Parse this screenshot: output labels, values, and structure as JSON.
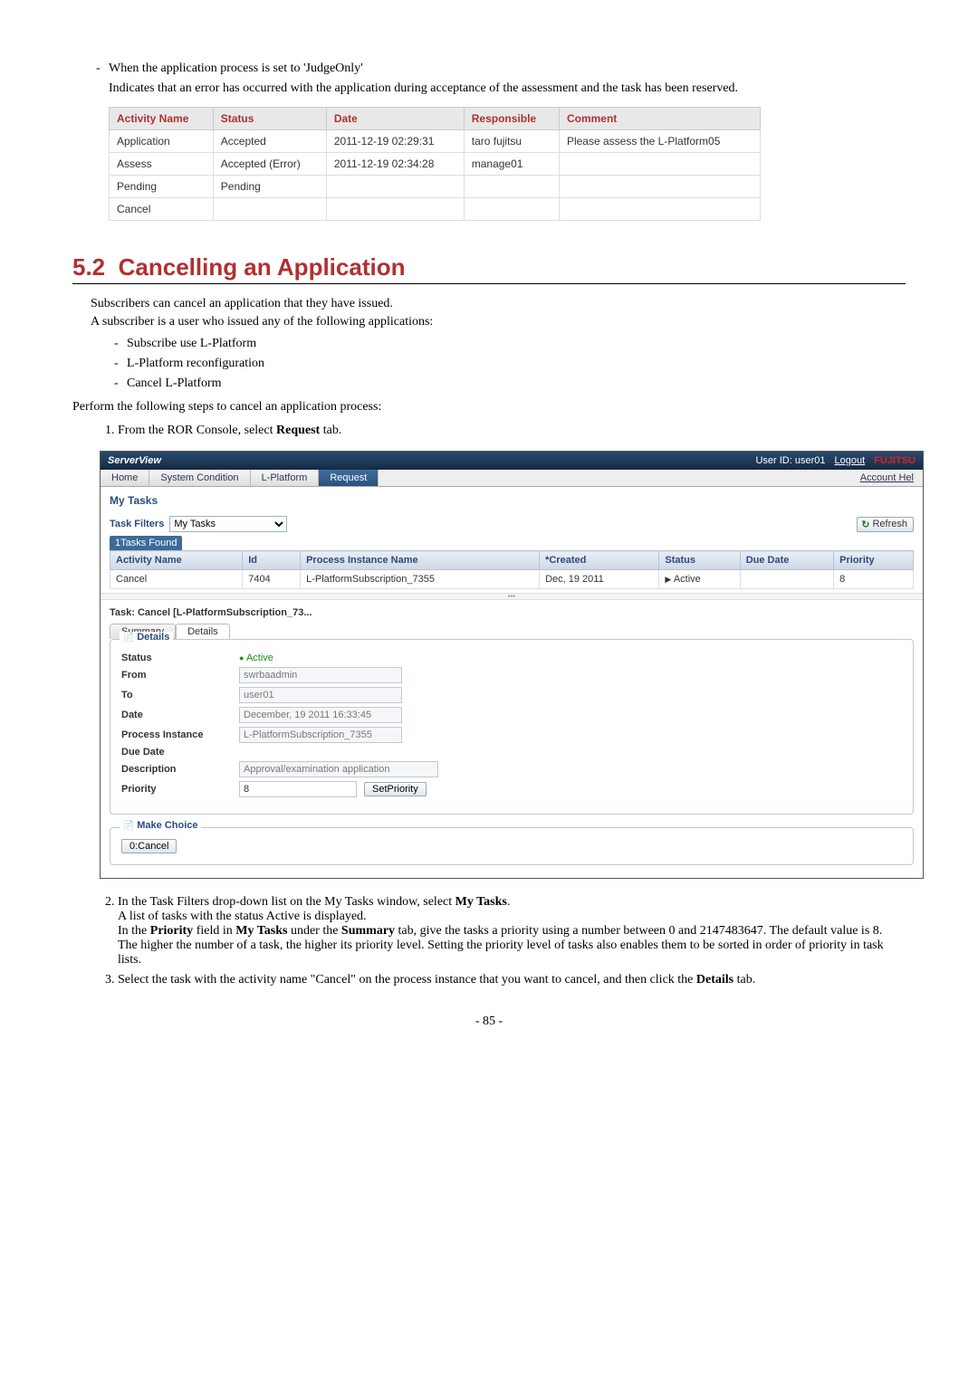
{
  "intro": {
    "bullet1": "When the application process is set to 'JudgeOnly'",
    "bullet1_desc": "Indicates that an error has occurred with the application during acceptance of the assessment and the task has been reserved."
  },
  "status_table": {
    "headers": [
      "Activity Name",
      "Status",
      "Date",
      "Responsible",
      "Comment"
    ],
    "rows": [
      [
        "Application",
        "Accepted",
        "2011-12-19 02:29:31",
        "taro fujitsu",
        "Please assess the L-Platform05"
      ],
      [
        "Assess",
        "Accepted (Error)",
        "2011-12-19 02:34:28",
        "manage01",
        ""
      ],
      [
        "Pending",
        "Pending",
        "",
        "",
        ""
      ],
      [
        "Cancel",
        "",
        "",
        "",
        ""
      ]
    ]
  },
  "section": {
    "number": "5.2",
    "title": "Cancelling an Application",
    "p1": "Subscribers can cancel an application that they have issued.",
    "p2": "A subscriber is a user who issued any of the following applications:",
    "bullets": [
      "Subscribe use L-Platform",
      "L-Platform reconfiguration",
      "Cancel L-Platform"
    ],
    "p3": "Perform the following steps to cancel an application process:",
    "step1_a": "From the ROR Console, select ",
    "step1_b": "Request",
    "step1_c": " tab."
  },
  "sv": {
    "brand": "ServerView",
    "user_label": "User ID: user01",
    "logout": "Logout",
    "vendor": "FUJITSU",
    "tabs": [
      "Home",
      "System Condition",
      "L-Platform",
      "Request"
    ],
    "account": "Account  Hel",
    "mytasks": "My Tasks",
    "filters_label": "Task Filters",
    "filters_value": "My Tasks",
    "refresh": "Refresh",
    "count": "1Tasks Found",
    "cols": [
      "Activity Name",
      "Id",
      "Process Instance Name",
      "*Created",
      "Status",
      "Due Date",
      "Priority"
    ],
    "row": {
      "activity": "Cancel",
      "id": "7404",
      "process": "L-PlatformSubscription_7355",
      "created": "Dec, 19 2011",
      "status": "Active",
      "due": "",
      "priority": "8"
    },
    "detail_title": "Task: Cancel [L-PlatformSubscription_73...",
    "inner_tabs": [
      "Summary",
      "Details"
    ],
    "legend_details": "Details",
    "fields": {
      "status_label": "Status",
      "status_value": "Active",
      "from_label": "From",
      "from_value": "swrbaadmin",
      "to_label": "To",
      "to_value": "user01",
      "date_label": "Date",
      "date_value": "December, 19 2011 16:33:45",
      "pi_label": "Process Instance",
      "pi_value": "L-PlatformSubscription_7355",
      "due_label": "Due Date",
      "due_value": "",
      "desc_label": "Description",
      "desc_value": "Approval/examination application",
      "prio_label": "Priority",
      "prio_value": "8",
      "setprio": "SetPriority"
    },
    "legend_choice": "Make Choice",
    "choice_btn": "0:Cancel"
  },
  "step2": {
    "l1a": "In the Task Filters drop-down list on the My Tasks window, select ",
    "l1b": "My Tasks",
    "l1c": ".",
    "l2": "A list of tasks with the status Active is displayed.",
    "l3a": "In the ",
    "l3b": "Priority",
    "l3c": " field in ",
    "l3d": "My Tasks",
    "l3e": " under the ",
    "l3f": "Summary",
    "l3g": " tab, give the tasks a priority using a number between 0 and 2147483647. The default value is 8.",
    "l4": "The higher the number of a task, the higher its priority level. Setting the priority level of tasks also enables them to be sorted in order of priority in task lists."
  },
  "step3": {
    "a": "Select the task with the activity name \"Cancel\" on the process instance that you want to cancel, and then click the ",
    "b": "Details",
    "c": " tab."
  },
  "page": "- 85 -"
}
